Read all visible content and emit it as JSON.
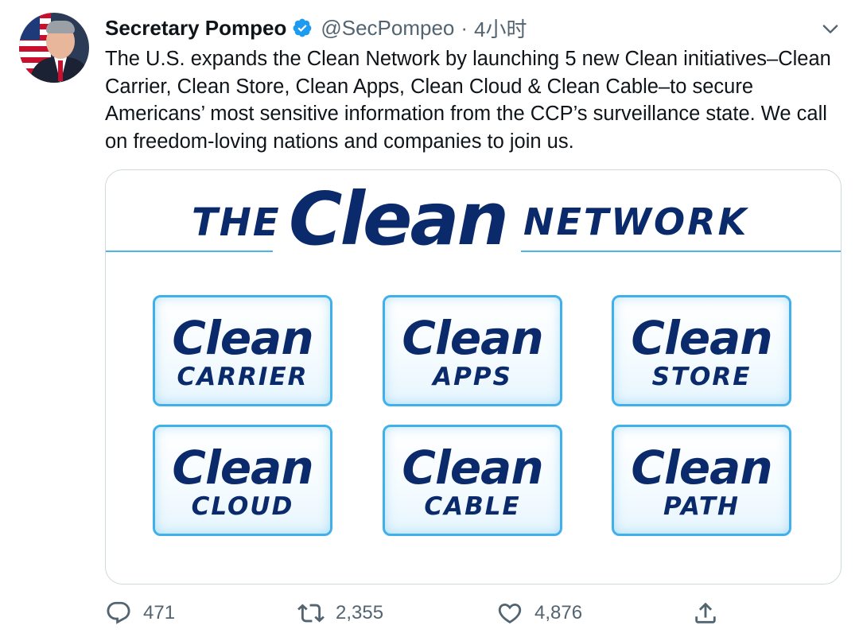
{
  "tweet": {
    "author_name": "Secretary Pompeo",
    "handle": "@SecPompeo",
    "separator": "·",
    "time": "4小时",
    "text": "The U.S. expands the Clean Network by launching 5 new Clean initiatives–Clean Carrier, Clean Store, Clean Apps, Clean Cloud & Clean Cable–to secure Americans’ most sensitive information from the CCP’s surveillance state. We call on freedom-loving nations and companies to join us."
  },
  "media": {
    "logo_the": "THE",
    "logo_clean": "Clean",
    "logo_network": "NETWORK",
    "tiles": [
      {
        "main": "Clean",
        "sub": "CARRIER"
      },
      {
        "main": "Clean",
        "sub": "APPS"
      },
      {
        "main": "Clean",
        "sub": "STORE"
      },
      {
        "main": "Clean",
        "sub": "CLOUD"
      },
      {
        "main": "Clean",
        "sub": "CABLE"
      },
      {
        "main": "Clean",
        "sub": "PATH"
      }
    ]
  },
  "actions": {
    "reply_count": "471",
    "retweet_count": "2,355",
    "like_count": "4,876"
  },
  "colors": {
    "brand_navy": "#0a2a6b",
    "accent_blue": "#3fb0ea",
    "verified_blue": "#1d9bf0",
    "secondary_text": "#536471"
  },
  "icons": [
    "verified-badge-icon",
    "chevron-down-icon",
    "reply-icon",
    "retweet-icon",
    "like-icon",
    "share-icon"
  ]
}
